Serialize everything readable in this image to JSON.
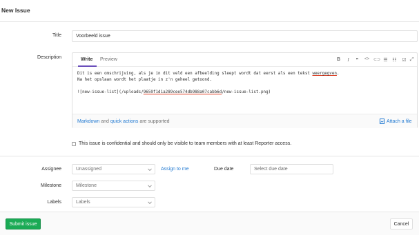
{
  "page_title": "New Issue",
  "title_field": {
    "label": "Title",
    "value": "Voorbeeld issue"
  },
  "description": {
    "label": "Description",
    "tabs": [
      "Write",
      "Preview"
    ],
    "toolbar": {
      "bold": "B",
      "italic": "I",
      "quote": "❞",
      "code": "<>",
      "link": "⊂⊃",
      "bullet_list": "☰",
      "numbered_list": "☷",
      "task_list": "☑",
      "fullscreen": "⤢"
    },
    "line1_before": "Dit is een omschrijving, als je in dit veld een afbeelding sleept wordt dat eerst als een tekst ",
    "line1_underlined": "weergegven",
    "line1_after": ".",
    "line2": "Na het opslaan wordt het plaatje in z'n geheel getoond.",
    "line4_before": "![new-issue-list](/uploads/",
    "line4_underlined": "9659f1d1a289cee574db988a07cabb6d",
    "line4_after": "/new-issue-list.png)",
    "footer_markdown": "Markdown",
    "footer_and": "and",
    "footer_quick_actions": "quick actions",
    "footer_supported": "are supported",
    "attach_label": "Attach a file"
  },
  "confidential_label": "This issue is confidential and should only be visible to team members with at least Reporter access.",
  "assignee": {
    "label": "Assignee",
    "value": "Unassigned",
    "assign_to_me": "Assign to me"
  },
  "due_date": {
    "label": "Due date",
    "placeholder": "Select due date"
  },
  "milestone": {
    "label": "Milestone",
    "value": "Milestone"
  },
  "labels": {
    "label": "Labels",
    "value": "Labels"
  },
  "buttons": {
    "submit": "Submit issue",
    "cancel": "Cancel"
  },
  "colors": {
    "accent": "#1aaa55",
    "link": "#1f78d1",
    "tab_underline": "#6b4fbb"
  }
}
